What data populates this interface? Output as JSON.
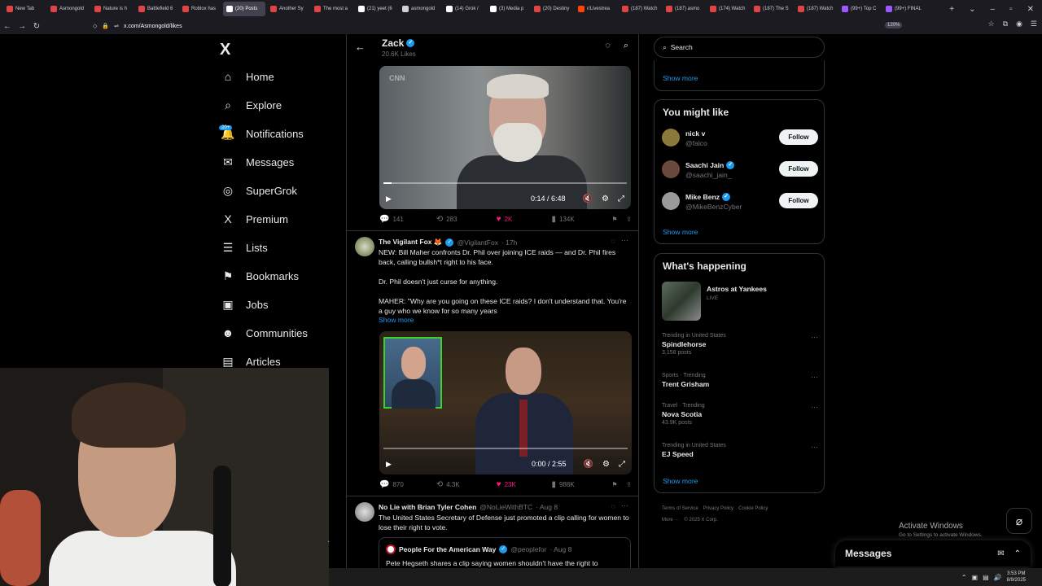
{
  "browser": {
    "tabs": [
      {
        "label": "New Tab",
        "color": "#e04545"
      },
      {
        "label": "Asmongold",
        "color": "#e04545"
      },
      {
        "label": "Nature is h",
        "color": "#e04545"
      },
      {
        "label": "Battlefield 6",
        "color": "#e04545"
      },
      {
        "label": "Roblox has",
        "color": "#e04545"
      },
      {
        "label": "(20) Posts",
        "color": "#ffffff",
        "active": true
      },
      {
        "label": "Another Sy",
        "color": "#e04545"
      },
      {
        "label": "The most a",
        "color": "#e04545"
      },
      {
        "label": "(21) yeet (6",
        "color": "#ffffff"
      },
      {
        "label": "asmongold",
        "color": "#cfcfd8"
      },
      {
        "label": "(14) Grok /",
        "color": "#ffffff"
      },
      {
        "label": "(3) Media p",
        "color": "#ffffff"
      },
      {
        "label": "(20) Destiny",
        "color": "#e04545"
      },
      {
        "label": "r/Livestrea",
        "color": "#ff4500"
      },
      {
        "label": "(187) Watch",
        "color": "#e04545"
      },
      {
        "label": "(187) asmo",
        "color": "#e04545"
      },
      {
        "label": "(174) Watch",
        "color": "#e04545"
      },
      {
        "label": "(187) The S",
        "color": "#e04545"
      },
      {
        "label": "(187) Watch",
        "color": "#e04545"
      },
      {
        "label": "(99+) Top C",
        "color": "#9b59ff"
      },
      {
        "label": "(99+) FINAL",
        "color": "#9b59ff"
      }
    ],
    "url": "x.com/Asmongold/likes",
    "zoom": "120%"
  },
  "nav": {
    "logo": "X",
    "items": [
      {
        "label": "Home",
        "icon": "home-icon",
        "glyph": "⌂"
      },
      {
        "label": "Explore",
        "icon": "search-icon",
        "glyph": "⌕"
      },
      {
        "label": "Notifications",
        "icon": "bell-icon",
        "glyph": "🔔"
      },
      {
        "label": "Messages",
        "icon": "envelope-icon",
        "glyph": "✉"
      },
      {
        "label": "SuperGrok",
        "icon": "grok-icon",
        "glyph": "◎"
      },
      {
        "label": "Premium",
        "icon": "x-premium-icon",
        "glyph": "X"
      },
      {
        "label": "Lists",
        "icon": "list-icon",
        "glyph": "☰"
      },
      {
        "label": "Bookmarks",
        "icon": "bookmark-icon",
        "glyph": "⚑"
      },
      {
        "label": "Jobs",
        "icon": "briefcase-icon",
        "glyph": "▣"
      },
      {
        "label": "Communities",
        "icon": "people-icon",
        "glyph": "☻"
      },
      {
        "label": "Articles",
        "icon": "article-icon",
        "glyph": "▤"
      }
    ],
    "notif_badge": "20+"
  },
  "profile": {
    "name": "Zack",
    "likes": "20.6K Likes"
  },
  "tweet1": {
    "video_time": "0:14 / 6:48",
    "video_progress": 0.034,
    "replies": "141",
    "reposts": "283",
    "likes": "2K",
    "views": "134K"
  },
  "tweet2": {
    "name": "The Vigilant Fox 🦊",
    "handle": "@VigilantFox",
    "time": "· 17h",
    "text": "NEW: Bill Maher confronts Dr. Phil over joining ICE raids — and Dr. Phil fires back, calling bullsh*t right to his face.\n\nDr. Phil doesn't just curse for anything.\n\nMAHER: \"Why are you going on these ICE raids? I don't understand that. You're a guy who we know for so many years",
    "show_more": "Show more",
    "video_time": "0:00 / 2:55",
    "video_progress": 0.0,
    "replies": "870",
    "reposts": "4.3K",
    "likes": "23K",
    "views": "988K"
  },
  "tweet3": {
    "name": "No Lie with Brian Tyler Cohen",
    "handle": "@NoLieWithBTC",
    "time": "· Aug 8",
    "text": "The United States Secretary of Defense just promoted a clip calling for women to lose their right to vote.",
    "quote": {
      "name": "People For the American Way",
      "handle": "@peoplefor",
      "time": "· Aug 8",
      "text": "Pete Hegseth shares a clip saying women shouldn't have the right to"
    }
  },
  "right": {
    "search_placeholder": "Search",
    "show_more_top": "Show more",
    "might_like_title": "You might like",
    "suggestions": [
      {
        "name": "nick v",
        "handle": "@falco",
        "verified": false,
        "color": "#8a7a3a"
      },
      {
        "name": "Saachi Jain",
        "handle": "@saachi_jain_",
        "verified": true,
        "color": "#6b4a3e"
      },
      {
        "name": "Mike Benz",
        "handle": "@MikeBenzCyber",
        "verified": true,
        "color": "#9a9a9a"
      }
    ],
    "follow_label": "Follow",
    "might_like_more": "Show more",
    "happening_title": "What's happening",
    "event": {
      "title": "Astros at Yankees",
      "status": "LIVE"
    },
    "trends": [
      {
        "category": "Trending in United States",
        "title": "Spindlehorse",
        "posts": "3,158 posts"
      },
      {
        "category": "Sports · Trending",
        "title": "Trent Grisham",
        "posts": ""
      },
      {
        "category": "Travel · Trending",
        "title": "Nova Scotia",
        "posts": "43.9K posts"
      },
      {
        "category": "Trending in United States",
        "title": "EJ Speed",
        "posts": ""
      }
    ],
    "happening_more": "Show more",
    "footer": [
      "Terms of Service",
      "Privacy Policy",
      "Cookie Policy",
      "More ···",
      "© 2025 X Corp."
    ]
  },
  "overlay": {
    "activate_title": "Activate Windows",
    "activate_sub": "Go to Settings to activate Windows.",
    "messages_label": "Messages"
  },
  "taskbar": {
    "time": "3:53 PM",
    "date": "8/9/2025"
  }
}
